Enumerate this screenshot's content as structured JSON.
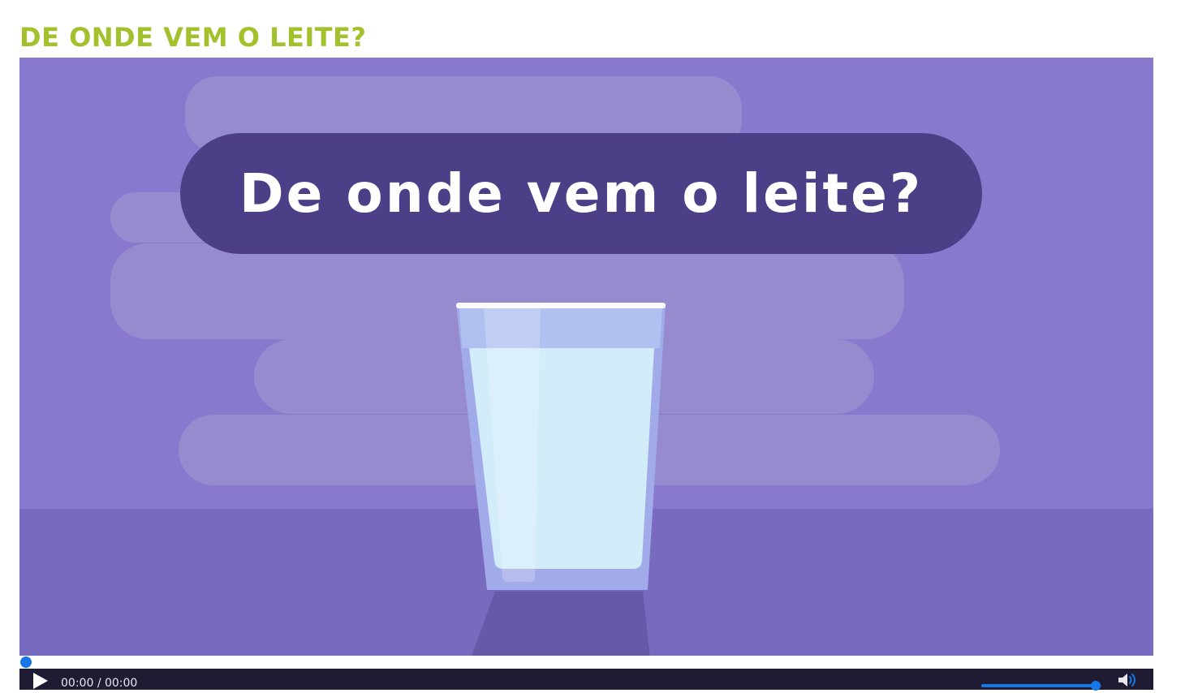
{
  "page": {
    "title": "DE ONDE VEM O LEITE?",
    "title_color": "#a3c12c"
  },
  "video": {
    "frame_caption": "De onde vem o leite?",
    "background_color": "#8878ce",
    "caption_pill_color": "#4c3f87",
    "scene_object": "glass-of-milk"
  },
  "player": {
    "current_time": "00:00",
    "separator": "/",
    "duration": "00:00",
    "progress_fraction": 0,
    "volume_fraction": 0.95,
    "accent_color": "#1677e8",
    "bar_color": "#1e1b33",
    "play_icon": "play-icon",
    "volume_icon": "speaker-icon"
  }
}
